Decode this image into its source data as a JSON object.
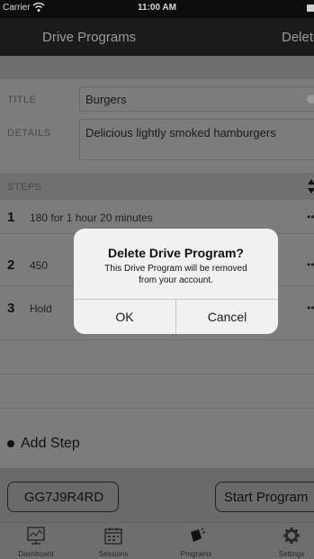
{
  "status_bar": {
    "carrier": "Carrier",
    "time": "11:00 AM"
  },
  "nav": {
    "title": "Drive Programs",
    "delete_label": "Delete"
  },
  "form": {
    "title_label": "TITLE",
    "title_value": "Burgers",
    "details_label": "DETAILS",
    "details_value": "Delicious lightly smoked hamburgers"
  },
  "steps": {
    "header": "STEPS",
    "items": [
      {
        "num": "1",
        "text": "180 for 1 hour 20 minutes"
      },
      {
        "num": "2",
        "text": "450"
      },
      {
        "num": "3",
        "text": "Hold"
      }
    ],
    "add_label": "Add Step"
  },
  "actions": {
    "code": "GG7J9R4RD",
    "start_label": "Start Program"
  },
  "tabs": [
    {
      "label": "Dashboard",
      "icon": "dashboard-icon"
    },
    {
      "label": "Sessions",
      "icon": "calendar-icon"
    },
    {
      "label": "Programs",
      "icon": "programs-icon"
    },
    {
      "label": "Settings",
      "icon": "gear-icon"
    }
  ],
  "alert": {
    "title": "Delete Drive Program?",
    "message_line1": "This Drive Program will be removed",
    "message_line2": "from your account.",
    "ok_label": "OK",
    "cancel_label": "Cancel"
  },
  "colors": {
    "nav_bg": "#1b1b1b",
    "overlay_content": "#7c7c7c",
    "alert_bg": "#f1f1f1"
  }
}
